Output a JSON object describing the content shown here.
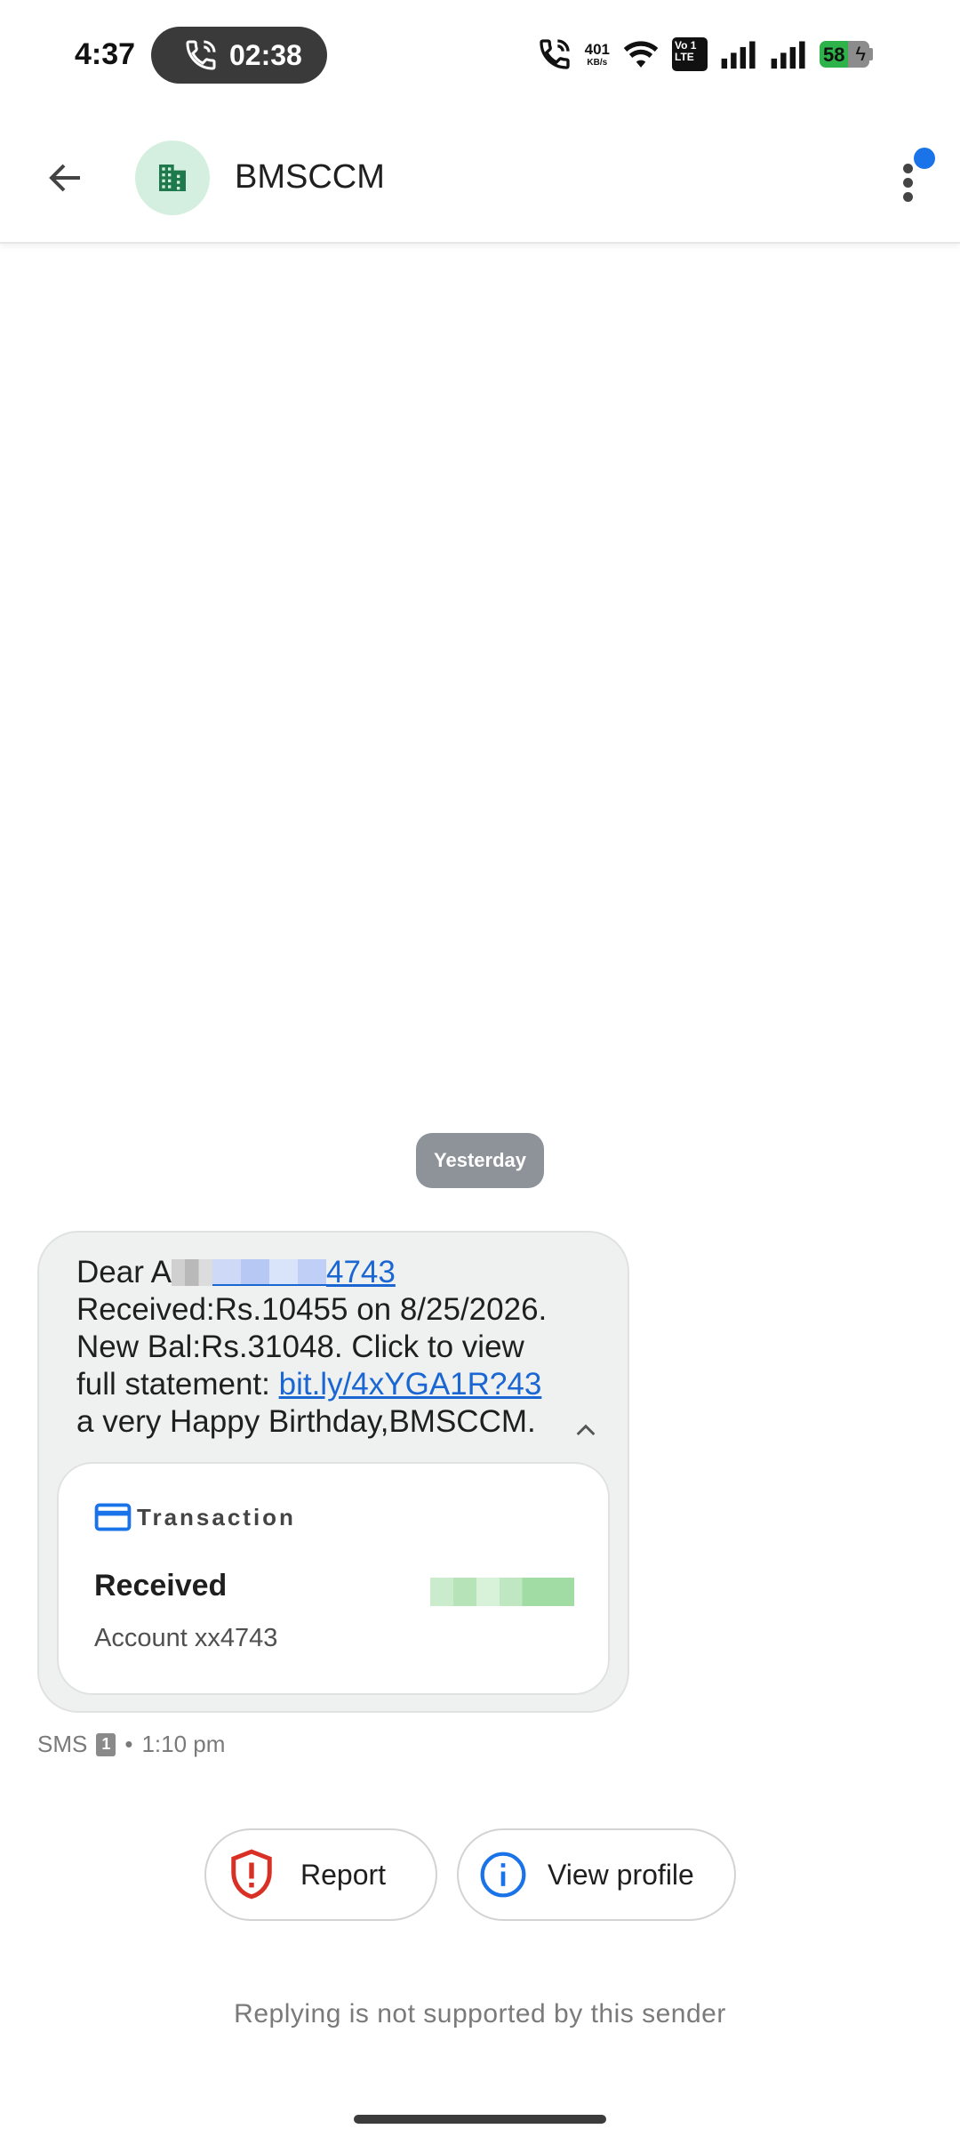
{
  "status_bar": {
    "time": "4:37",
    "call_timer": "02:38",
    "net_speed_value": "401",
    "net_speed_unit": "KB/s",
    "volte_line1": "Vo 1",
    "volte_line2": "LTE",
    "battery_level": 58
  },
  "app_bar": {
    "contact_name": "BMSCCM",
    "avatar_icon": "building-icon",
    "avatar_color": "#d4efe0"
  },
  "conversation": {
    "date_chip": "Yesterday",
    "message": {
      "greeting": "Dear A",
      "account_suffix": "4743",
      "line2": "Received:Rs.10455 on 8/25/2026.",
      "line3": "New Bal:Rs.31048. Click to view",
      "line4_prefix": "full statement: ",
      "link": "bit.ly/4xYGA1R?43",
      "line5": "a very Happy Birthday,BMSCCM."
    },
    "card": {
      "label": "Transaction",
      "title": "Received",
      "account": "Account xx4743"
    },
    "meta": {
      "channel": "SMS",
      "sim": "1",
      "separator": "•",
      "time": "1:10 pm"
    }
  },
  "actions": {
    "report_label": "Report",
    "view_profile_label": "View profile"
  },
  "footer_note": "Replying is not supported by this sender",
  "colors": {
    "accent_blue": "#1a73e8",
    "link_blue": "#1a66d2",
    "report_red": "#d93025",
    "battery_green": "#2db34a",
    "bubble_bg": "#eff1f0"
  }
}
